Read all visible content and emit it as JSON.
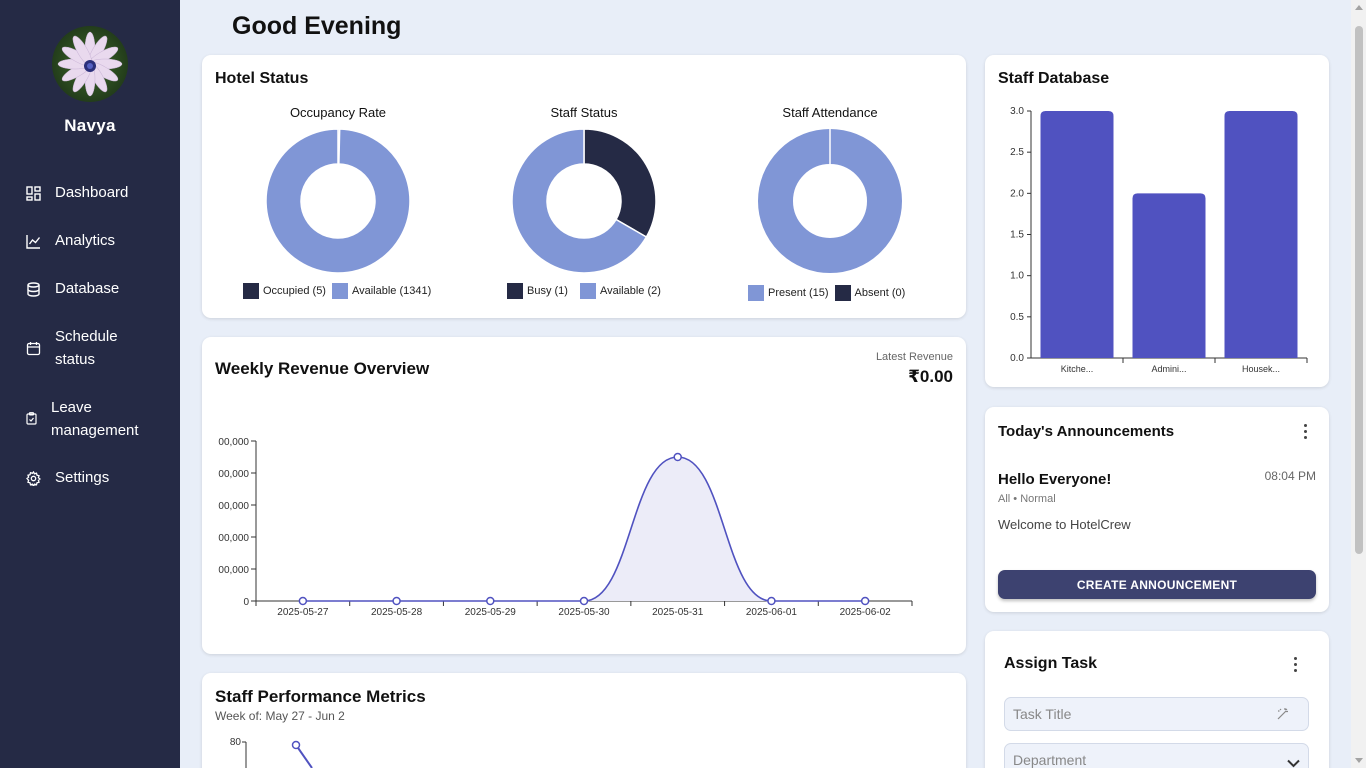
{
  "sidebar": {
    "user_name": "Navya",
    "items": [
      {
        "label": "Dashboard",
        "icon": "dashboard-icon"
      },
      {
        "label": "Analytics",
        "icon": "chart-icon"
      },
      {
        "label": "Database",
        "icon": "database-icon"
      },
      {
        "label": "Schedule status",
        "icon": "calendar-icon"
      },
      {
        "label": "Leave management",
        "icon": "clipboard-icon"
      },
      {
        "label": "Settings",
        "icon": "gear-icon"
      }
    ]
  },
  "greeting": "Good Evening",
  "hotel_status": {
    "title": "Hotel Status",
    "occupancy": {
      "title": "Occupancy Rate",
      "legend": [
        "Occupied (5)",
        "Available (1341)"
      ]
    },
    "staff_status": {
      "title": "Staff Status",
      "legend": [
        "Busy (1)",
        "Available (2)"
      ]
    },
    "attendance": {
      "title": "Staff Attendance",
      "legend": [
        "Present (15)",
        "Absent (0)"
      ]
    }
  },
  "staff_database": {
    "title": "Staff Database"
  },
  "revenue": {
    "title": "Weekly Revenue Overview",
    "latest_label": "Latest Revenue",
    "latest_value": "₹0.00"
  },
  "performance": {
    "title": "Staff Performance Metrics",
    "subtitle": "Week of: May 27 - Jun 2"
  },
  "announcements": {
    "title": "Today's Announcements",
    "item": {
      "heading": "Hello Everyone!",
      "time": "08:04 PM",
      "meta": "All • Normal",
      "body": "Welcome to HotelCrew"
    },
    "button": "CREATE ANNOUNCEMENT"
  },
  "assign_task": {
    "title": "Assign Task",
    "title_placeholder": "Task Title",
    "department_placeholder": "Department"
  },
  "colors": {
    "sidebar": "#252a45",
    "dark": "#252a45",
    "light": "#8096d6",
    "bar": "#5052c0",
    "accent": "#3d4270"
  },
  "chart_data": [
    {
      "type": "pie",
      "title": "Occupancy Rate",
      "labels": [
        "Occupied",
        "Available"
      ],
      "values": [
        5,
        1341
      ]
    },
    {
      "type": "pie",
      "title": "Staff Status",
      "labels": [
        "Busy",
        "Available"
      ],
      "values": [
        1,
        2
      ]
    },
    {
      "type": "pie",
      "title": "Staff Attendance",
      "labels": [
        "Present",
        "Absent"
      ],
      "values": [
        15,
        0
      ]
    },
    {
      "type": "bar",
      "title": "Staff Database",
      "categories": [
        "Kitche...",
        "Admini...",
        "Housek..."
      ],
      "values": [
        3,
        2,
        3
      ],
      "yticks": [
        "0.0",
        "0.5",
        "1.0",
        "1.5",
        "2.0",
        "2.5",
        "3.0"
      ],
      "ylim": [
        0,
        3
      ]
    },
    {
      "type": "area",
      "title": "Weekly Revenue Overview",
      "x": [
        "2025-05-27",
        "2025-05-28",
        "2025-05-29",
        "2025-05-30",
        "2025-05-31",
        "2025-06-01",
        "2025-06-02"
      ],
      "values": [
        0,
        0,
        0,
        0,
        45000,
        0,
        0
      ],
      "yticks": [
        "0",
        "00,000",
        "00,000",
        "00,000",
        "00,000",
        "00,000"
      ],
      "ylim": [
        0,
        50000
      ]
    },
    {
      "type": "line",
      "title": "Staff Performance Metrics",
      "yticks": [
        "80"
      ]
    }
  ]
}
